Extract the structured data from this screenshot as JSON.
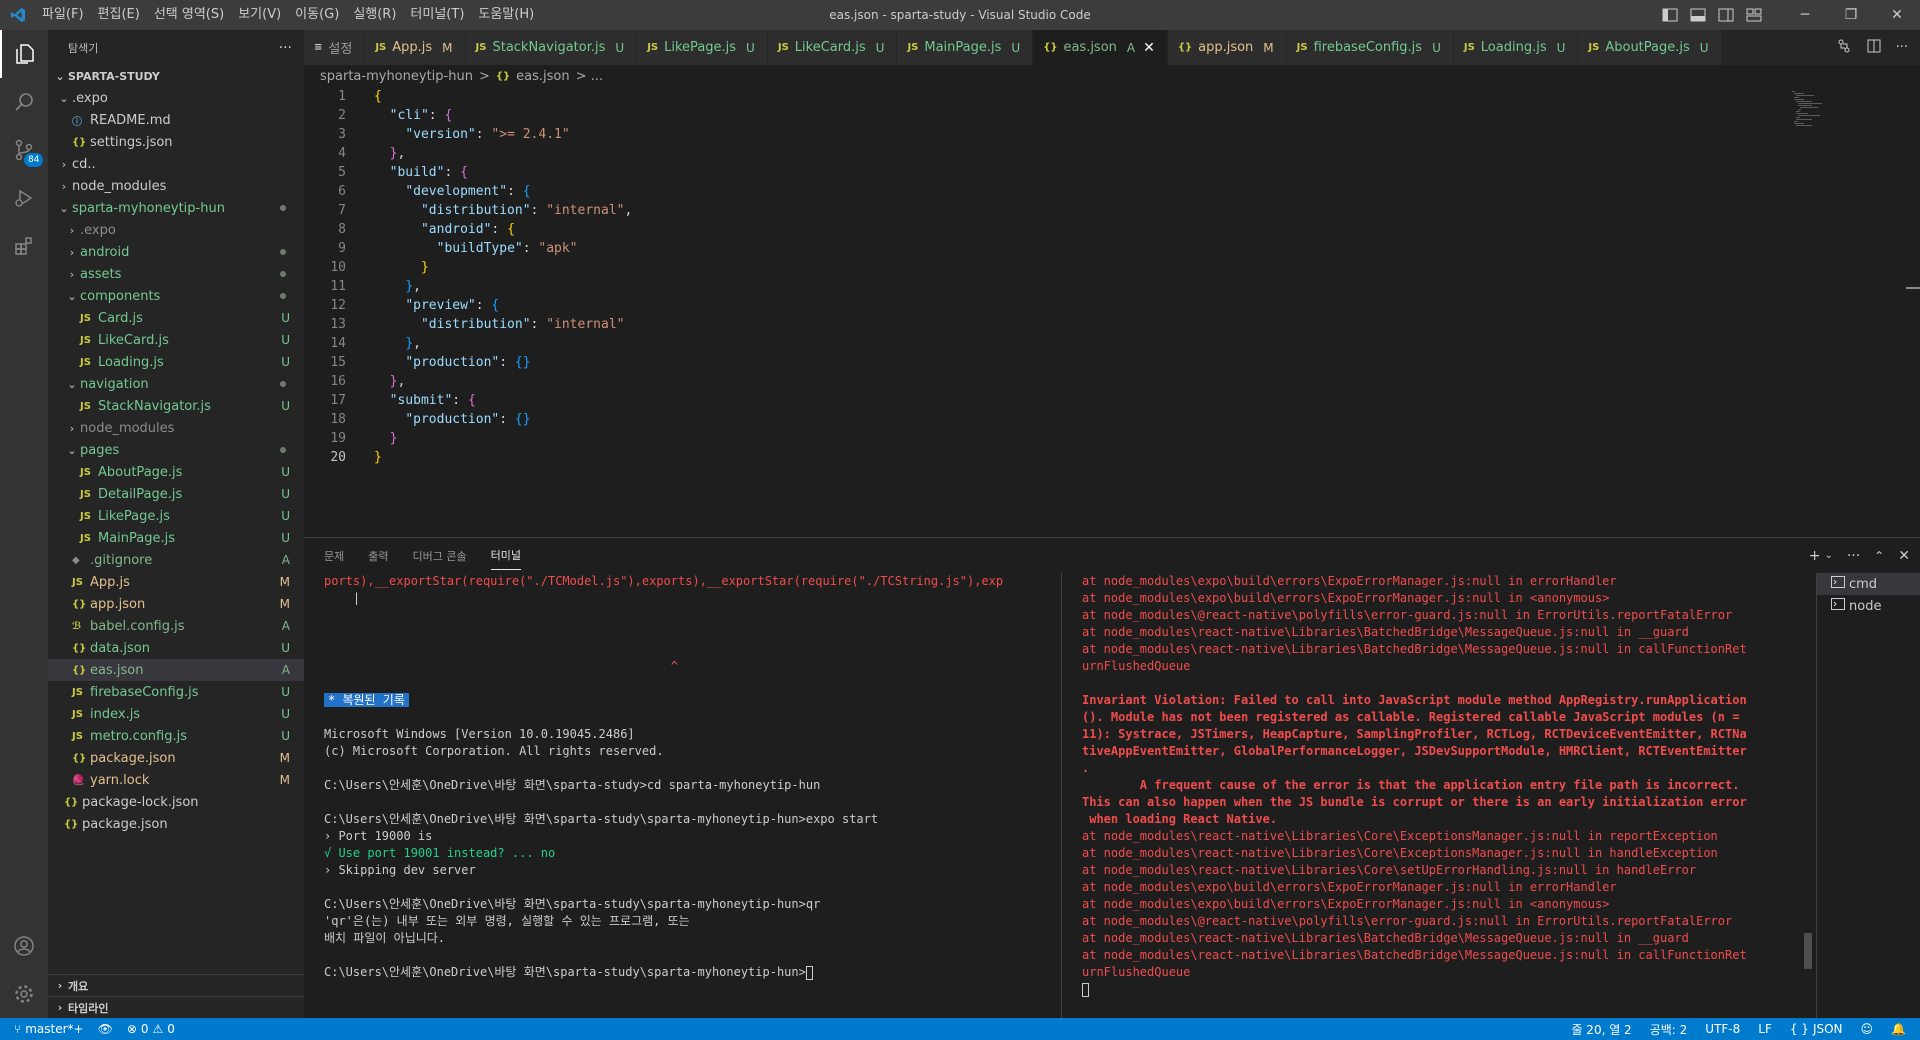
{
  "window": {
    "title": "eas.json - sparta-study - Visual Studio Code",
    "menu": [
      "파일(F)",
      "편집(E)",
      "선택 영역(S)",
      "보기(V)",
      "이동(G)",
      "실행(R)",
      "터미널(T)",
      "도움말(H)"
    ]
  },
  "activity": {
    "scm_badge": "84"
  },
  "sidebar": {
    "title": "탐색기",
    "more": "···",
    "root": "SPARTA-STUDY",
    "items": [
      {
        "label": ".expo",
        "depth": 0,
        "chev": "open",
        "icon": "",
        "status": "",
        "cls": ""
      },
      {
        "label": "README.md",
        "depth": 1,
        "chev": "",
        "icon": "ⓘ",
        "iconcls": "info",
        "status": "",
        "cls": ""
      },
      {
        "label": "settings.json",
        "depth": 1,
        "chev": "",
        "icon": "{}",
        "iconcls": "json",
        "status": "",
        "cls": ""
      },
      {
        "label": "cd..",
        "depth": 0,
        "chev": "closed",
        "icon": "",
        "status": "",
        "cls": ""
      },
      {
        "label": "node_modules",
        "depth": 0,
        "chev": "closed",
        "icon": "",
        "status": "",
        "cls": ""
      },
      {
        "label": "sparta-myhoneytip-hun",
        "depth": 0,
        "chev": "open",
        "icon": "",
        "status": "dot",
        "cls": "clr-U"
      },
      {
        "label": ".expo",
        "depth": 1,
        "chev": "closed",
        "icon": "",
        "status": "",
        "cls": "clr-dim"
      },
      {
        "label": "android",
        "depth": 1,
        "chev": "closed",
        "icon": "",
        "status": "dot",
        "cls": "clr-U"
      },
      {
        "label": "assets",
        "depth": 1,
        "chev": "closed",
        "icon": "",
        "status": "dot",
        "cls": "clr-U"
      },
      {
        "label": "components",
        "depth": 1,
        "chev": "open",
        "icon": "",
        "status": "dot",
        "cls": "clr-U"
      },
      {
        "label": "Card.js",
        "depth": 2,
        "chev": "",
        "icon": "JS",
        "iconcls": "js",
        "status": "U",
        "cls": "clr-U"
      },
      {
        "label": "LikeCard.js",
        "depth": 2,
        "chev": "",
        "icon": "JS",
        "iconcls": "js",
        "status": "U",
        "cls": "clr-U"
      },
      {
        "label": "Loading.js",
        "depth": 2,
        "chev": "",
        "icon": "JS",
        "iconcls": "js",
        "status": "U",
        "cls": "clr-U"
      },
      {
        "label": "navigation",
        "depth": 1,
        "chev": "open",
        "icon": "",
        "status": "dot",
        "cls": "clr-U"
      },
      {
        "label": "StackNavigator.js",
        "depth": 2,
        "chev": "",
        "icon": "JS",
        "iconcls": "js",
        "status": "U",
        "cls": "clr-U"
      },
      {
        "label": "node_modules",
        "depth": 1,
        "chev": "closed",
        "icon": "",
        "status": "",
        "cls": "clr-dim"
      },
      {
        "label": "pages",
        "depth": 1,
        "chev": "open",
        "icon": "",
        "status": "dot",
        "cls": "clr-U"
      },
      {
        "label": "AboutPage.js",
        "depth": 2,
        "chev": "",
        "icon": "JS",
        "iconcls": "js",
        "status": "U",
        "cls": "clr-U"
      },
      {
        "label": "DetailPage.js",
        "depth": 2,
        "chev": "",
        "icon": "JS",
        "iconcls": "js",
        "status": "U",
        "cls": "clr-U"
      },
      {
        "label": "LikePage.js",
        "depth": 2,
        "chev": "",
        "icon": "JS",
        "iconcls": "js",
        "status": "U",
        "cls": "clr-U"
      },
      {
        "label": "MainPage.js",
        "depth": 2,
        "chev": "",
        "icon": "JS",
        "iconcls": "js",
        "status": "U",
        "cls": "clr-U"
      },
      {
        "label": ".gitignore",
        "depth": 1,
        "chev": "",
        "icon": "◆",
        "iconcls": "clr-dim",
        "status": "A",
        "cls": "clr-A"
      },
      {
        "label": "App.js",
        "depth": 1,
        "chev": "",
        "icon": "JS",
        "iconcls": "js",
        "status": "M",
        "cls": "clr-M"
      },
      {
        "label": "app.json",
        "depth": 1,
        "chev": "",
        "icon": "{}",
        "iconcls": "json",
        "status": "M",
        "cls": "clr-M"
      },
      {
        "label": "babel.config.js",
        "depth": 1,
        "chev": "",
        "icon": "ℬ",
        "iconcls": "js",
        "status": "A",
        "cls": "clr-A"
      },
      {
        "label": "data.json",
        "depth": 1,
        "chev": "",
        "icon": "{}",
        "iconcls": "json",
        "status": "U",
        "cls": "clr-U"
      },
      {
        "label": "eas.json",
        "depth": 1,
        "chev": "",
        "icon": "{}",
        "iconcls": "json",
        "status": "A",
        "cls": "clr-A",
        "selected": true
      },
      {
        "label": "firebaseConfig.js",
        "depth": 1,
        "chev": "",
        "icon": "JS",
        "iconcls": "js",
        "status": "U",
        "cls": "clr-U"
      },
      {
        "label": "index.js",
        "depth": 1,
        "chev": "",
        "icon": "JS",
        "iconcls": "js",
        "status": "U",
        "cls": "clr-U"
      },
      {
        "label": "metro.config.js",
        "depth": 1,
        "chev": "",
        "icon": "JS",
        "iconcls": "js",
        "status": "U",
        "cls": "clr-U"
      },
      {
        "label": "package.json",
        "depth": 1,
        "chev": "",
        "icon": "{}",
        "iconcls": "json",
        "status": "M",
        "cls": "clr-M"
      },
      {
        "label": "yarn.lock",
        "depth": 1,
        "chev": "",
        "icon": "🧶",
        "iconcls": "info",
        "status": "M",
        "cls": "clr-M"
      },
      {
        "label": "package-lock.json",
        "depth": 0,
        "chev": "",
        "icon": "{}",
        "iconcls": "json",
        "status": "",
        "cls": ""
      },
      {
        "label": "package.json",
        "depth": 0,
        "chev": "",
        "icon": "{}",
        "iconcls": "json",
        "status": "",
        "cls": ""
      }
    ],
    "outline": "개요",
    "timeline": "타임라인"
  },
  "tabs": [
    {
      "icon": "≡",
      "label": "설정",
      "status": "",
      "cls": ""
    },
    {
      "icon": "JS",
      "label": "App.js",
      "status": "M",
      "cls": "clr-M"
    },
    {
      "icon": "JS",
      "label": "StackNavigator.js",
      "status": "U",
      "cls": "clr-U"
    },
    {
      "icon": "JS",
      "label": "LikePage.js",
      "status": "U",
      "cls": "clr-U"
    },
    {
      "icon": "JS",
      "label": "LikeCard.js",
      "status": "U",
      "cls": "clr-U"
    },
    {
      "icon": "JS",
      "label": "MainPage.js",
      "status": "U",
      "cls": "clr-U"
    },
    {
      "icon": "{}",
      "label": "eas.json",
      "status": "A",
      "cls": "clr-A",
      "active": true
    },
    {
      "icon": "{}",
      "label": "app.json",
      "status": "M",
      "cls": "clr-M"
    },
    {
      "icon": "JS",
      "label": "firebaseConfig.js",
      "status": "U",
      "cls": "clr-U"
    },
    {
      "icon": "JS",
      "label": "Loading.js",
      "status": "U",
      "cls": "clr-U"
    },
    {
      "icon": "JS",
      "label": "AboutPage.js",
      "status": "U",
      "cls": "clr-U"
    }
  ],
  "breadcrumb": {
    "folder": "sparta-myhoneytip-hun",
    "sep": ">",
    "file_icon": "{}",
    "file": "eas.json",
    "rest": "> ..."
  },
  "editor": {
    "current_line": 20,
    "lines": [
      [
        [
          "b1",
          "{"
        ]
      ],
      [
        [
          "p",
          "  "
        ],
        [
          "k",
          "\"cli\""
        ],
        [
          "p",
          ": "
        ],
        [
          "b2",
          "{"
        ]
      ],
      [
        [
          "p",
          "    "
        ],
        [
          "k",
          "\"version\""
        ],
        [
          "p",
          ": "
        ],
        [
          "s",
          "\">= 2.4.1\""
        ]
      ],
      [
        [
          "p",
          "  "
        ],
        [
          "b2",
          "}"
        ],
        [
          "p",
          ","
        ]
      ],
      [
        [
          "p",
          "  "
        ],
        [
          "k",
          "\"build\""
        ],
        [
          "p",
          ": "
        ],
        [
          "b2",
          "{"
        ]
      ],
      [
        [
          "p",
          "    "
        ],
        [
          "k",
          "\"development\""
        ],
        [
          "p",
          ": "
        ],
        [
          "b3",
          "{"
        ]
      ],
      [
        [
          "p",
          "      "
        ],
        [
          "k",
          "\"distribution\""
        ],
        [
          "p",
          ": "
        ],
        [
          "s",
          "\"internal\""
        ],
        [
          "p",
          ","
        ]
      ],
      [
        [
          "p",
          "      "
        ],
        [
          "k",
          "\"android\""
        ],
        [
          "p",
          ": "
        ],
        [
          "b1",
          "{"
        ]
      ],
      [
        [
          "p",
          "        "
        ],
        [
          "k",
          "\"buildType\""
        ],
        [
          "p",
          ": "
        ],
        [
          "s",
          "\"apk\""
        ]
      ],
      [
        [
          "p",
          "      "
        ],
        [
          "b1",
          "}"
        ]
      ],
      [
        [
          "p",
          "    "
        ],
        [
          "b3",
          "}"
        ],
        [
          "p",
          ","
        ]
      ],
      [
        [
          "p",
          "    "
        ],
        [
          "k",
          "\"preview\""
        ],
        [
          "p",
          ": "
        ],
        [
          "b3",
          "{"
        ]
      ],
      [
        [
          "p",
          "      "
        ],
        [
          "k",
          "\"distribution\""
        ],
        [
          "p",
          ": "
        ],
        [
          "s",
          "\"internal\""
        ]
      ],
      [
        [
          "p",
          "    "
        ],
        [
          "b3",
          "}"
        ],
        [
          "p",
          ","
        ]
      ],
      [
        [
          "p",
          "    "
        ],
        [
          "k",
          "\"production\""
        ],
        [
          "p",
          ": "
        ],
        [
          "b3",
          "{}"
        ]
      ],
      [
        [
          "p",
          "  "
        ],
        [
          "b2",
          "}"
        ],
        [
          "p",
          ","
        ]
      ],
      [
        [
          "p",
          "  "
        ],
        [
          "k",
          "\"submit\""
        ],
        [
          "p",
          ": "
        ],
        [
          "b2",
          "{"
        ]
      ],
      [
        [
          "p",
          "    "
        ],
        [
          "k",
          "\"production\""
        ],
        [
          "p",
          ": "
        ],
        [
          "b3",
          "{}"
        ]
      ],
      [
        [
          "p",
          "  "
        ],
        [
          "b2",
          "}"
        ]
      ],
      [
        [
          "b1",
          "}"
        ]
      ]
    ]
  },
  "panel": {
    "tabs": [
      "문제",
      "출력",
      "디버그 콘솔",
      "터미널"
    ],
    "active_tab": 3,
    "terminals": [
      "cmd",
      "node"
    ],
    "left": [
      {
        "t": "ports),__exportStar(require(\"./TCModel.js\"),exports),__exportStar(require(\"./TCString.js\"),exp",
        "c": "red"
      },
      {
        "t": "    |",
        "c": ""
      },
      {
        "t": "",
        "c": ""
      },
      {
        "t": "",
        "c": ""
      },
      {
        "t": "",
        "c": ""
      },
      {
        "t": "                                                ^",
        "c": "red"
      },
      {
        "t": "",
        "c": ""
      },
      {
        "t": "* 복원된 기록",
        "c": "hl"
      },
      {
        "t": "",
        "c": ""
      },
      {
        "t": "Microsoft Windows [Version 10.0.19045.2486]",
        "c": ""
      },
      {
        "t": "(c) Microsoft Corporation. All rights reserved.",
        "c": ""
      },
      {
        "t": "",
        "c": ""
      },
      {
        "t": "C:\\Users\\안세훈\\OneDrive\\바탕 화면\\sparta-study>cd sparta-myhoneytip-hun",
        "c": ""
      },
      {
        "t": "",
        "c": ""
      },
      {
        "t": "C:\\Users\\안세훈\\OneDrive\\바탕 화면\\sparta-study\\sparta-myhoneytip-hun>expo start",
        "c": ""
      },
      {
        "t": "› Port 19000 is",
        "c": ""
      },
      {
        "t": "√ Use port 19001 instead? ... no",
        "c": "green"
      },
      {
        "t": "› Skipping dev server",
        "c": ""
      },
      {
        "t": "",
        "c": ""
      },
      {
        "t": "C:\\Users\\안세훈\\OneDrive\\바탕 화면\\sparta-study\\sparta-myhoneytip-hun>qr",
        "c": ""
      },
      {
        "t": "'qr'은(는) 내부 또는 외부 명령, 실행할 수 있는 프로그램, 또는",
        "c": ""
      },
      {
        "t": "배치 파일이 아닙니다.",
        "c": ""
      },
      {
        "t": "",
        "c": ""
      },
      {
        "t": "C:\\Users\\안세훈\\OneDrive\\바탕 화면\\sparta-study\\sparta-myhoneytip-hun>",
        "c": "",
        "cursor": true
      }
    ],
    "right": [
      {
        "t": "at node_modules\\expo\\build\\errors\\ExpoErrorManager.js:null in errorHandler",
        "c": "red"
      },
      {
        "t": "at node_modules\\expo\\build\\errors\\ExpoErrorManager.js:null in <anonymous>",
        "c": "red"
      },
      {
        "t": "at node_modules\\@react-native\\polyfills\\error-guard.js:null in ErrorUtils.reportFatalError",
        "c": "red"
      },
      {
        "t": "at node_modules\\react-native\\Libraries\\BatchedBridge\\MessageQueue.js:null in __guard",
        "c": "red"
      },
      {
        "t": "at node_modules\\react-native\\Libraries\\BatchedBridge\\MessageQueue.js:null in callFunctionRet",
        "c": "red"
      },
      {
        "t": "urnFlushedQueue",
        "c": "red"
      },
      {
        "t": "",
        "c": ""
      },
      {
        "t": "Invariant Violation: Failed to call into JavaScript module method AppRegistry.runApplication",
        "c": "redb"
      },
      {
        "t": "(). Module has not been registered as callable. Registered callable JavaScript modules (n =",
        "c": "redb"
      },
      {
        "t": "11): Systrace, JSTimers, HeapCapture, SamplingProfiler, RCTLog, RCTDeviceEventEmitter, RCTNa",
        "c": "redb"
      },
      {
        "t": "tiveAppEventEmitter, GlobalPerformanceLogger, JSDevSupportModule, HMRClient, RCTEventEmitter",
        "c": "redb"
      },
      {
        "t": ".",
        "c": "redb"
      },
      {
        "t": "        A frequent cause of the error is that the application entry file path is incorrect.",
        "c": "redb"
      },
      {
        "t": "This can also happen when the JS bundle is corrupt or there is an early initialization error",
        "c": "redb"
      },
      {
        "t": " when loading React Native.",
        "c": "redb"
      },
      {
        "t": "at node_modules\\react-native\\Libraries\\Core\\ExceptionsManager.js:null in reportException",
        "c": "red"
      },
      {
        "t": "at node_modules\\react-native\\Libraries\\Core\\ExceptionsManager.js:null in handleException",
        "c": "red"
      },
      {
        "t": "at node_modules\\react-native\\Libraries\\Core\\setUpErrorHandling.js:null in handleError",
        "c": "red"
      },
      {
        "t": "at node_modules\\expo\\build\\errors\\ExpoErrorManager.js:null in errorHandler",
        "c": "red"
      },
      {
        "t": "at node_modules\\expo\\build\\errors\\ExpoErrorManager.js:null in <anonymous>",
        "c": "red"
      },
      {
        "t": "at node_modules\\@react-native\\polyfills\\error-guard.js:null in ErrorUtils.reportFatalError",
        "c": "red"
      },
      {
        "t": "at node_modules\\react-native\\Libraries\\BatchedBridge\\MessageQueue.js:null in __guard",
        "c": "red"
      },
      {
        "t": "at node_modules\\react-native\\Libraries\\BatchedBridge\\MessageQueue.js:null in callFunctionRet",
        "c": "red"
      },
      {
        "t": "urnFlushedQueue",
        "c": "red"
      },
      {
        "t": "",
        "c": "",
        "cursor": true
      }
    ]
  },
  "statusbar": {
    "branch": "master*+",
    "errors": "0",
    "warnings": "0",
    "position": "줄 20, 열 2",
    "spaces": "공백: 2",
    "encoding": "UTF-8",
    "eol": "LF",
    "language": "JSON",
    "language_icon": "{ }"
  }
}
